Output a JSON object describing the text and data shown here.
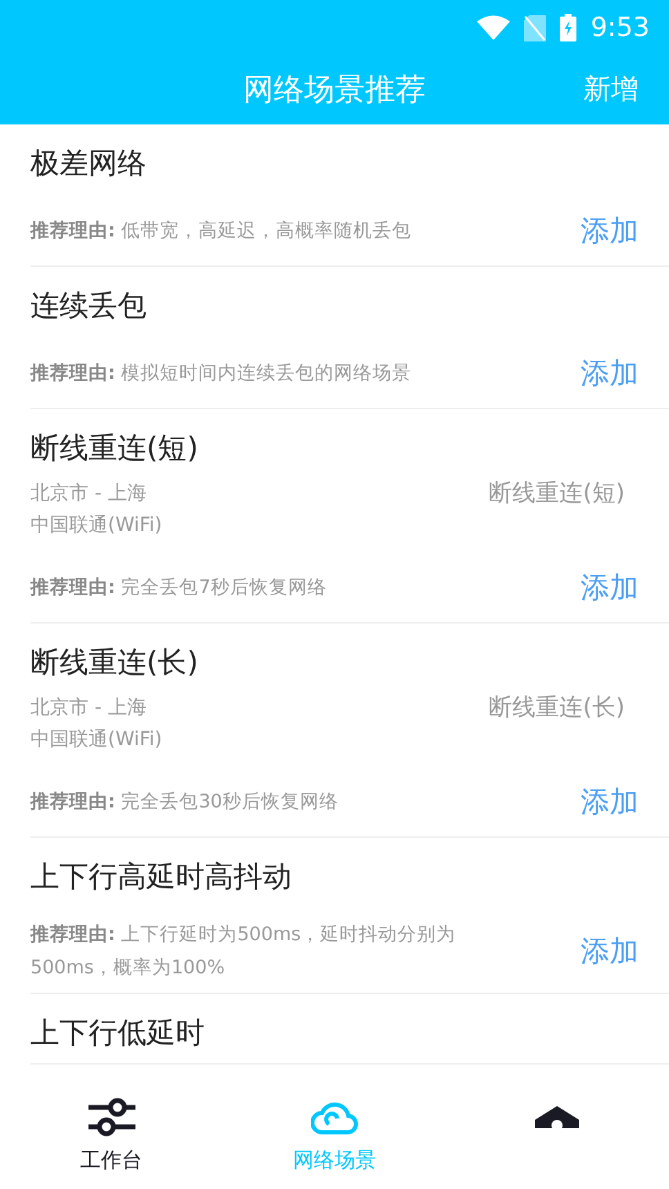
{
  "status_bar": {
    "time": "9:53"
  },
  "header": {
    "title": "网络场景推荐",
    "action": "新增"
  },
  "scenarios": [
    {
      "title": "极差网络",
      "reason_label": "推荐理由:",
      "reason": "低带宽，高延迟，高概率随机丢包",
      "add": "添加"
    },
    {
      "title": "连续丢包",
      "reason_label": "推荐理由:",
      "reason": "模拟短时间内连续丢包的网络场景",
      "add": "添加"
    },
    {
      "title": "断线重连(短)",
      "route": "北京市 - 上海",
      "carrier": "中国联通(WiFi)",
      "scene": "断线重连(短)",
      "reason_label": "推荐理由:",
      "reason": "完全丢包7秒后恢复网络",
      "add": "添加"
    },
    {
      "title": "断线重连(长)",
      "route": "北京市 - 上海",
      "carrier": "中国联通(WiFi)",
      "scene": "断线重连(长)",
      "reason_label": "推荐理由:",
      "reason": "完全丢包30秒后恢复网络",
      "add": "添加"
    },
    {
      "title": "上下行高延时高抖动",
      "reason_label": "推荐理由:",
      "reason": "上下行延时为500ms，延时抖动分别为500ms，概率为100%",
      "add": "添加"
    },
    {
      "title": "上下行低延时"
    }
  ],
  "tab_bar": [
    {
      "kind": "sliders",
      "label": "工作台",
      "selected": false
    },
    {
      "kind": "cloud",
      "label": "网络场景",
      "selected": true
    },
    {
      "kind": "shield",
      "selected": false
    }
  ]
}
